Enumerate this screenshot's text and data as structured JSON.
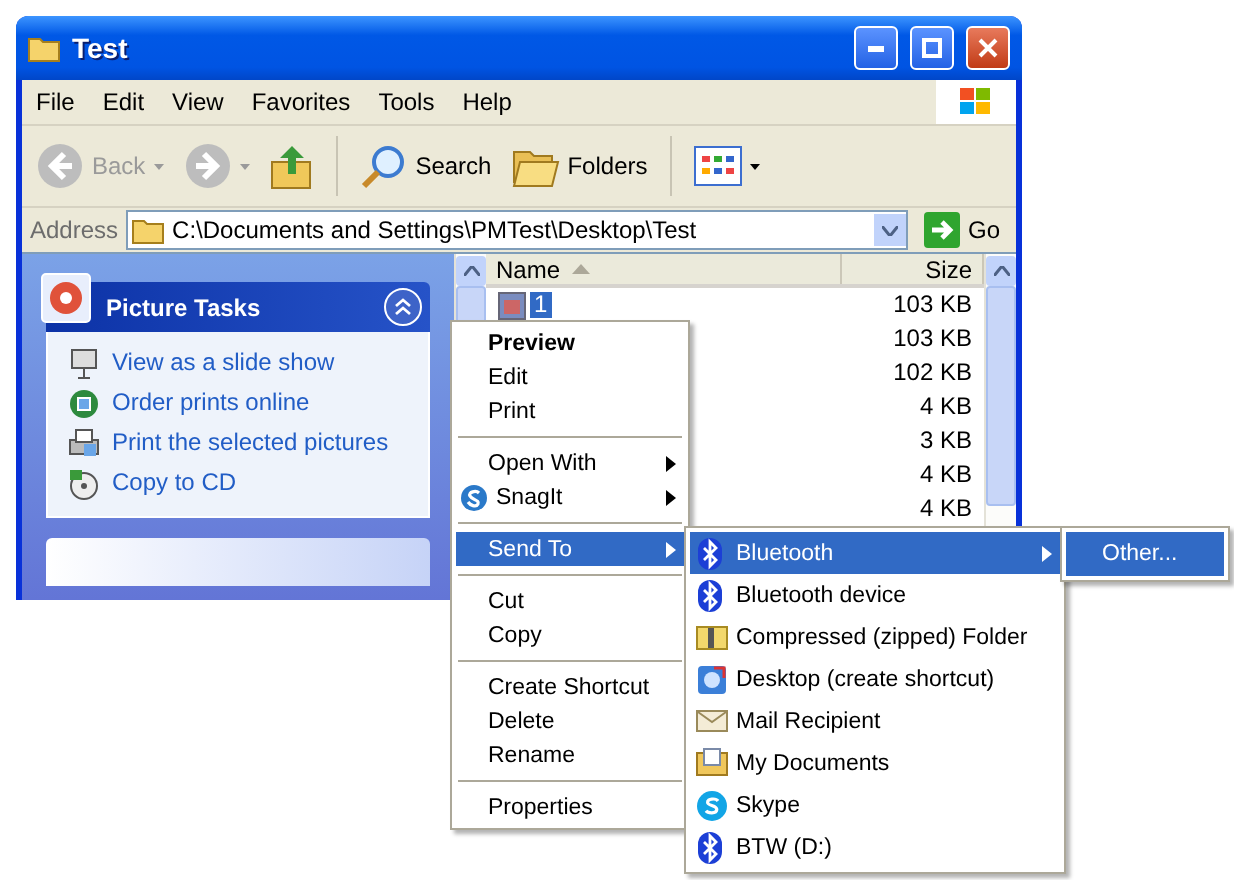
{
  "window": {
    "title": "Test"
  },
  "menu_bar": [
    "File",
    "Edit",
    "View",
    "Favorites",
    "Tools",
    "Help"
  ],
  "toolbar": {
    "back": {
      "label": "Back",
      "disabled": true
    },
    "search": "Search",
    "folders": "Folders"
  },
  "address_bar": {
    "label": "Address",
    "value": "C:\\Documents and Settings\\PMTest\\Desktop\\Test",
    "go": "Go"
  },
  "task_pane": {
    "title": "Picture Tasks",
    "expanded": true,
    "tasks": [
      "View as a slide show",
      "Order prints online",
      "Print the selected pictures",
      "Copy to CD"
    ]
  },
  "file_list": {
    "columns": [
      "Name",
      "Size"
    ],
    "rows": [
      {
        "name": "1",
        "size": "103 KB",
        "selected": true
      },
      {
        "size": "103 KB",
        "selected": false
      },
      {
        "size": "102 KB",
        "selected": false
      },
      {
        "size": "4 KB",
        "selected": false
      },
      {
        "size": "3 KB",
        "selected": false
      },
      {
        "size": "4 KB",
        "selected": false
      },
      {
        "size": "4 KB",
        "selected": false
      }
    ]
  },
  "context_menu": {
    "items": [
      {
        "kind": "item",
        "label": "Preview",
        "default": true,
        "submenu": false,
        "selected": false
      },
      {
        "kind": "item",
        "label": "Edit",
        "default": false,
        "submenu": false,
        "selected": false
      },
      {
        "kind": "item",
        "label": "Print",
        "default": false,
        "submenu": false,
        "selected": false
      },
      {
        "kind": "separator"
      },
      {
        "kind": "item",
        "label": "Open With",
        "default": false,
        "submenu": true,
        "selected": false
      },
      {
        "kind": "item",
        "label": "SnagIt",
        "default": false,
        "submenu": true,
        "selected": false
      },
      {
        "kind": "separator"
      },
      {
        "kind": "item",
        "label": "Send To",
        "default": false,
        "submenu": true,
        "selected": true
      },
      {
        "kind": "separator"
      },
      {
        "kind": "item",
        "label": "Cut",
        "default": false,
        "submenu": false,
        "selected": false
      },
      {
        "kind": "item",
        "label": "Copy",
        "default": false,
        "submenu": false,
        "selected": false
      },
      {
        "kind": "separator"
      },
      {
        "kind": "item",
        "label": "Create Shortcut",
        "default": false,
        "submenu": false,
        "selected": false
      },
      {
        "kind": "item",
        "label": "Delete",
        "default": false,
        "submenu": false,
        "selected": false
      },
      {
        "kind": "item",
        "label": "Rename",
        "default": false,
        "submenu": false,
        "selected": false
      },
      {
        "kind": "separator"
      },
      {
        "kind": "item",
        "label": "Properties",
        "default": false,
        "submenu": false,
        "selected": false
      }
    ]
  },
  "send_to_menu": {
    "items": [
      {
        "label": "Bluetooth",
        "submenu": true,
        "selected": true
      },
      {
        "label": "Bluetooth device",
        "submenu": false,
        "selected": false
      },
      {
        "label": "Compressed (zipped) Folder",
        "submenu": false,
        "selected": false
      },
      {
        "label": "Desktop (create shortcut)",
        "submenu": false,
        "selected": false
      },
      {
        "label": "Mail Recipient",
        "submenu": false,
        "selected": false
      },
      {
        "label": "My Documents",
        "submenu": false,
        "selected": false
      },
      {
        "label": "Skype",
        "submenu": false,
        "selected": false
      },
      {
        "label": "BTW (D:)",
        "submenu": false,
        "selected": false
      }
    ]
  },
  "bluetooth_menu": {
    "items": [
      {
        "label": "Other...",
        "selected": true
      }
    ]
  }
}
